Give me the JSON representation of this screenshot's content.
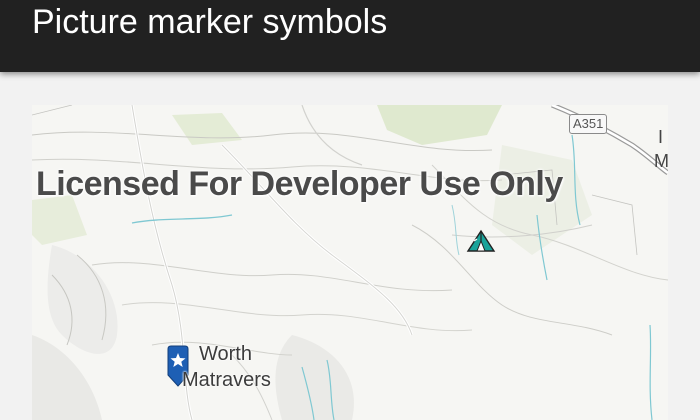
{
  "app": {
    "title": "Picture marker symbols"
  },
  "map": {
    "watermark": "Licensed For Developer Use Only",
    "road_label": "A351",
    "place_label_line1": "Worth",
    "place_label_line2": "Matravers",
    "edge_label_1": "I",
    "edge_label_2": "M",
    "markers": [
      {
        "name": "campsite-icon",
        "symbol": "tent"
      },
      {
        "name": "pin-star-icon",
        "symbol": "blue pin with star"
      }
    ]
  },
  "colors": {
    "appbar": "#212121",
    "pin": "#1e5fb4",
    "tent": "#1aa39a"
  }
}
